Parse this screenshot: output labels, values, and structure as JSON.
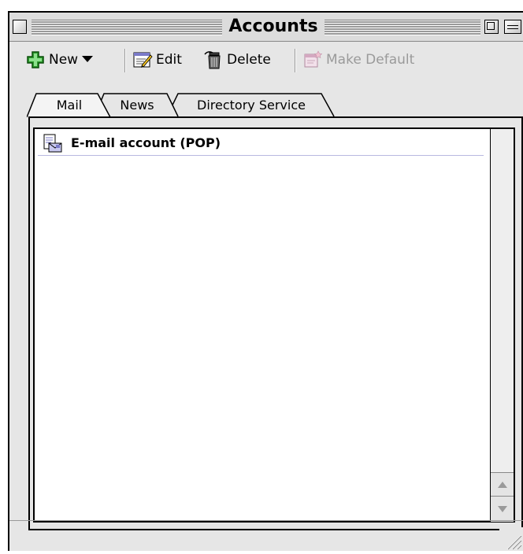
{
  "window": {
    "title": "Accounts"
  },
  "toolbar": {
    "new_label": "New",
    "edit_label": "Edit",
    "delete_label": "Delete",
    "make_default_label": "Make Default"
  },
  "tabs": [
    {
      "label": "Mail",
      "selected": true
    },
    {
      "label": "News",
      "selected": false
    },
    {
      "label": "Directory Service",
      "selected": false
    }
  ],
  "accounts": [
    {
      "name": "E-mail account (POP)",
      "icon": "email-account-icon"
    }
  ],
  "colors": {
    "window_bg": "#e6e6e6",
    "new_icon": "#2e9b2e",
    "list_row_border": "#b8b8e0"
  }
}
